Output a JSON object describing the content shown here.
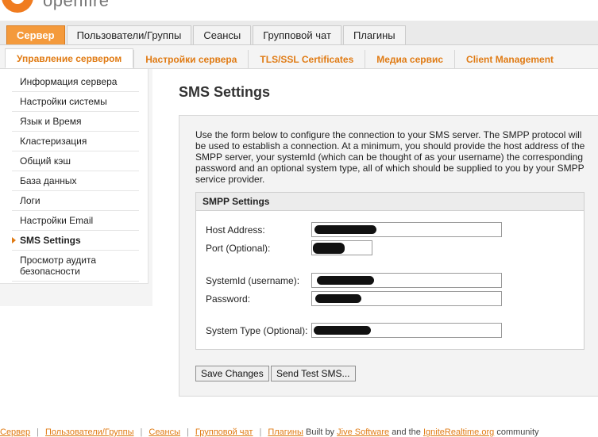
{
  "header": {
    "logo_text": "openfire"
  },
  "main_tabs": [
    "Сервер",
    "Пользователи/Группы",
    "Сеансы",
    "Групповой чат",
    "Плагины"
  ],
  "sub_tabs": [
    "Управление сервером",
    "Настройки сервера",
    "TLS/SSL Certificates",
    "Медиа сервис",
    "Client Management"
  ],
  "sidebar": {
    "items": [
      "Информация сервера",
      "Настройки системы",
      "Язык и Время",
      "Кластеризация",
      "Общий кэш",
      "База данных",
      "Логи",
      "Настройки Email",
      "SMS Settings",
      "Просмотр аудита безопасности"
    ],
    "active": "SMS Settings"
  },
  "page": {
    "title": "SMS Settings",
    "description": "Use the form below to configure the connection to your SMS server. The SMPP protocol will be used to establish a connection. At a minimum, you should provide the host address of the SMPP server, your systemId (which can be thought of as your username) the corresponding password and an optional system type, all of which should be supplied to you by your SMPP service provider.",
    "panel_title": "SMPP Settings",
    "fields": {
      "host": {
        "label": "Host Address:"
      },
      "port": {
        "label": "Port (Optional):"
      },
      "systemid": {
        "label": "SystemId (username):"
      },
      "password": {
        "label": "Password:"
      },
      "systemtype": {
        "label": "System Type (Optional):"
      }
    },
    "buttons": {
      "save": "Save Changes",
      "test": "Send Test SMS..."
    }
  },
  "footer": {
    "links": [
      "Сервер",
      "Пользователи/Группы",
      "Сеансы",
      "Групповой чат",
      "Плагины"
    ],
    "built_by": "Built by",
    "company": "Jive Software",
    "and_the": "and the",
    "community_site": "IgniteRealtime.org",
    "community": "community"
  },
  "colors": {
    "accent": "#f49a3c",
    "link": "#e07b14"
  }
}
